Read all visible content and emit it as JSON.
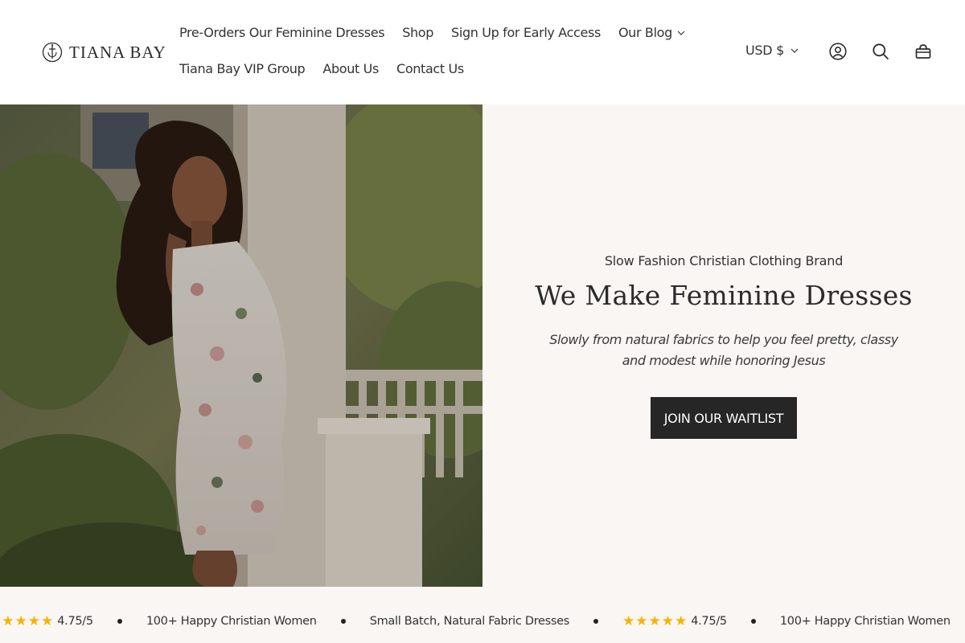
{
  "brand": {
    "name": "TIANA BAY"
  },
  "nav": {
    "row1": [
      {
        "label": "Pre-Orders Our Feminine Dresses",
        "dropdown": false
      },
      {
        "label": "Shop",
        "dropdown": false
      },
      {
        "label": "Sign Up for Early Access",
        "dropdown": false
      },
      {
        "label": "Our Blog",
        "dropdown": true
      }
    ],
    "row2": [
      {
        "label": "Tiana Bay VIP Group"
      },
      {
        "label": "About Us"
      },
      {
        "label": "Contact Us"
      }
    ]
  },
  "header": {
    "currency": "USD $",
    "icons": [
      "account-icon",
      "search-icon",
      "cart-icon"
    ]
  },
  "hero": {
    "subheading": "Slow Fashion Christian Clothing Brand",
    "title": "We Make Feminine Dresses",
    "description": "Slowly from natural fabrics to help you feel pretty, classy and modest while honoring Jesus",
    "cta": "JOIN OUR WAITLIST"
  },
  "marquee": {
    "rating": "4.75/5",
    "happy": "100+ Happy Christian Women",
    "fabric": "Small Batch, Natural Fabric Dresses"
  },
  "colors": {
    "page_background": "#f9f6f3",
    "header_background": "#ffffff",
    "button_background": "#262626",
    "star": "#f5b400",
    "text": "#2b2b2b"
  }
}
